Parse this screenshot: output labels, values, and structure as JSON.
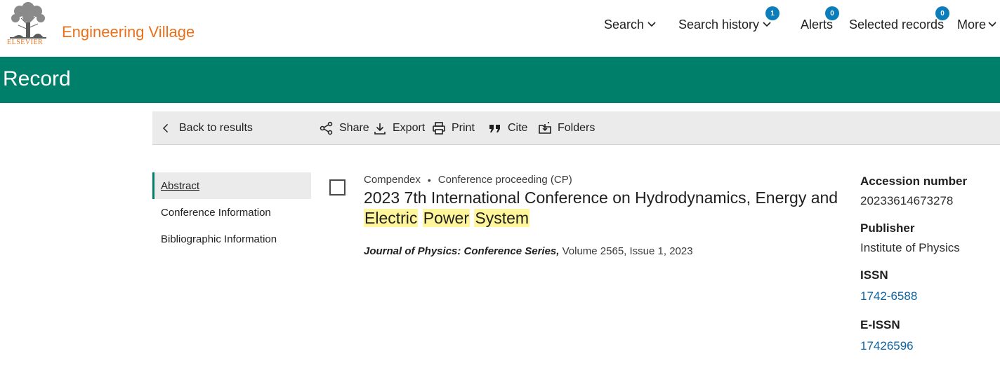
{
  "header": {
    "brand_word": "ELSEVIER",
    "app_title": "Engineering Village",
    "nav": [
      {
        "label": "Search"
      },
      {
        "label": "Search history",
        "badge": "1"
      },
      {
        "label": "Alerts",
        "badge": "0"
      },
      {
        "label": "Selected records",
        "badge": "0"
      },
      {
        "label": "More"
      }
    ]
  },
  "band": {
    "title": "Record"
  },
  "toolbar": {
    "back": "Back to results",
    "share": "Share",
    "export": "Export",
    "print": "Print",
    "cite": "Cite",
    "folders": "Folders"
  },
  "sidebar": {
    "items": [
      {
        "label": "Abstract",
        "active": true
      },
      {
        "label": "Conference Information"
      },
      {
        "label": "Bibliographic Information"
      }
    ]
  },
  "record": {
    "database": "Compendex",
    "doc_type": "Conference proceeding (CP)",
    "title_plain": "2023 7th International Conference on Hydrodynamics, Energy and",
    "title_hl": [
      "Electric",
      "Power",
      "System"
    ],
    "source_journal": "Journal of Physics: Conference Series,",
    "source_rest": "Volume 2565, Issue 1, 2023"
  },
  "details": {
    "accession_label": "Accession number",
    "accession_value": "20233614673278",
    "publisher_label": "Publisher",
    "publisher_value": "Institute of Physics",
    "issn_label": "ISSN",
    "issn_value": "1742-6588",
    "eissn_label": "E-ISSN",
    "eissn_value": "17426596"
  },
  "colors": {
    "brand_orange": "#e9711c",
    "band_green": "#007f6a",
    "badge_blue": "#0c7dbb",
    "highlight": "#fff59a",
    "link_blue": "#0c63a2"
  }
}
